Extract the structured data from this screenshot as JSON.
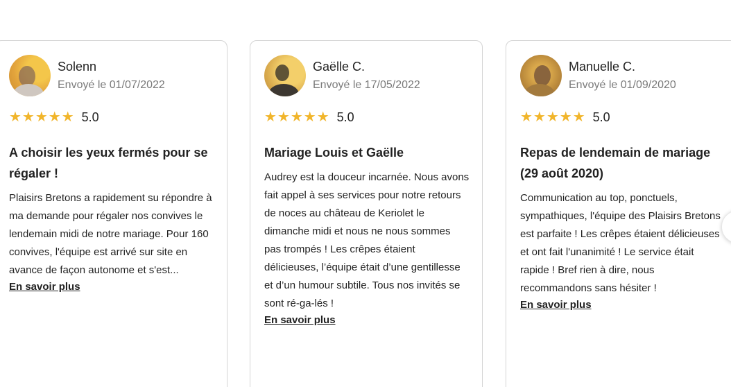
{
  "reviews": [
    {
      "name": "Solenn",
      "date": "Envoyé le 01/07/2022",
      "stars": "★★★★★",
      "score": "5.0",
      "title": "A choisir les yeux fermés pour se régaler !",
      "text": "Plaisirs Bretons a rapidement su répondre à ma demande pour régaler nos convives le lendemain midi de notre mariage. Pour 160 convives, l'équipe est arrivé sur site en avance de façon autonome et s'est...",
      "more": "En savoir plus"
    },
    {
      "name": "Gaëlle C.",
      "date": "Envoyé le 17/05/2022",
      "stars": "★★★★★",
      "score": "5.0",
      "title": "Mariage Louis et Gaëlle",
      "text": "Audrey est la douceur incarnée. Nous avons fait appel à ses services pour notre retours de noces au château de Keriolet le dimanche midi et nous ne nous sommes pas trompés ! Les crêpes étaient délicieuses, l’équipe était d’une gentillesse et d’un humour subtile. Tous nos invités se sont ré-ga-lés !",
      "more": "En savoir plus"
    },
    {
      "name": "Manuelle C.",
      "date": "Envoyé le 01/09/2020",
      "stars": "★★★★★",
      "score": "5.0",
      "title": "Repas de lendemain de mariage (29 août 2020)",
      "text": "Communication au top, ponctuels, sympathiques, l'équipe des Plaisirs Bretons est parfaite ! Les crêpes étaient délicieuses et ont fait l'unanimité ! Le service était rapide ! Bref rien à dire, nous recommandons sans hésiter !",
      "more": "En savoir plus"
    }
  ],
  "colors": {
    "star": "#f1b52b",
    "text": "#222222",
    "muted": "#7a7a7a",
    "border": "#d4d4d4"
  },
  "icons": {
    "star": "star-icon",
    "prev": "previous-arrow-icon",
    "next": "next-arrow-icon"
  }
}
